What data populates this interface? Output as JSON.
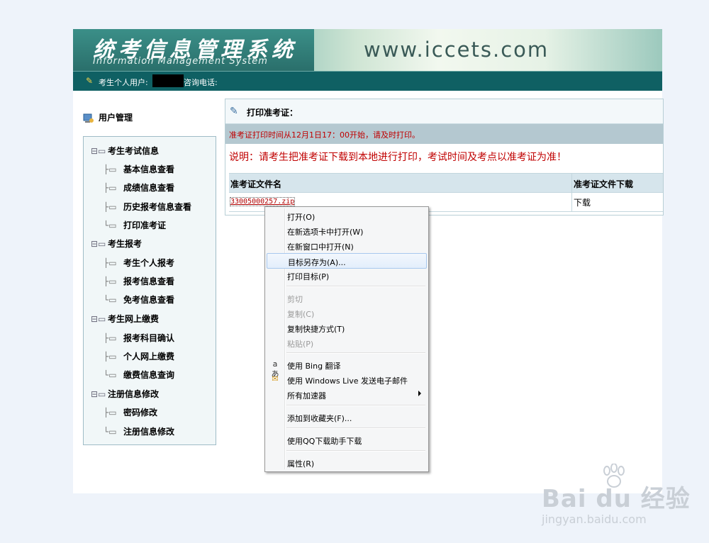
{
  "header": {
    "title_cn": "统考信息管理系统",
    "title_en": "Information Management System",
    "site_url": "www.iccets.com"
  },
  "userbar": {
    "user_label": "考生个人用户:",
    "phone_label": "咨询电话:"
  },
  "sidebar": {
    "title": "用户管理",
    "groups": [
      {
        "label": "考生考试信息",
        "items": [
          "基本信息查看",
          "成绩信息查看",
          "历史报考信息查看",
          "打印准考证"
        ]
      },
      {
        "label": "考生报考",
        "items": [
          "考生个人报考",
          "报考信息查看",
          "免考信息查看"
        ]
      },
      {
        "label": "考生网上缴费",
        "items": [
          "报考科目确认",
          "个人网上缴费",
          "缴费信息查询"
        ]
      },
      {
        "label": "注册信息修改",
        "items": [
          "密码修改",
          "注册信息修改"
        ]
      }
    ]
  },
  "main": {
    "panel_title": "打印准考证：",
    "notice": "准考证打印时间从12月1日17：00开始，请及时打印。",
    "description": "说明：请考生把准考证下载到本地进行打印，考试时间及考点以准考证为准！",
    "table": {
      "headers": [
        "准考证文件名",
        "准考证文件下载"
      ],
      "rows": [
        {
          "file": "33005000257.zip",
          "action": "下载"
        }
      ]
    }
  },
  "context_menu": {
    "items": [
      {
        "label": "打开(O)"
      },
      {
        "label": "在新选项卡中打开(W)"
      },
      {
        "label": "在新窗口中打开(N)"
      },
      {
        "label": "目标另存为(A)...",
        "highlighted": true
      },
      {
        "label": "打印目标(P)"
      },
      {
        "label": "剪切",
        "disabled": true
      },
      {
        "label": "复制(C)",
        "disabled": true
      },
      {
        "label": "复制快捷方式(T)"
      },
      {
        "label": "粘贴(P)",
        "disabled": true
      },
      {
        "label": "使用 Bing 翻译",
        "icon": "translate-icon"
      },
      {
        "label": "使用 Windows Live 发送电子邮件",
        "icon": "email-icon"
      },
      {
        "label": "所有加速器",
        "submenu": true
      },
      {
        "label": "添加到收藏夹(F)..."
      },
      {
        "label": "使用QQ下载助手下载"
      },
      {
        "label": "属性(R)"
      }
    ]
  },
  "watermark": {
    "logo": "Bai du 经验",
    "sub": "jingyan.baidu.com"
  }
}
